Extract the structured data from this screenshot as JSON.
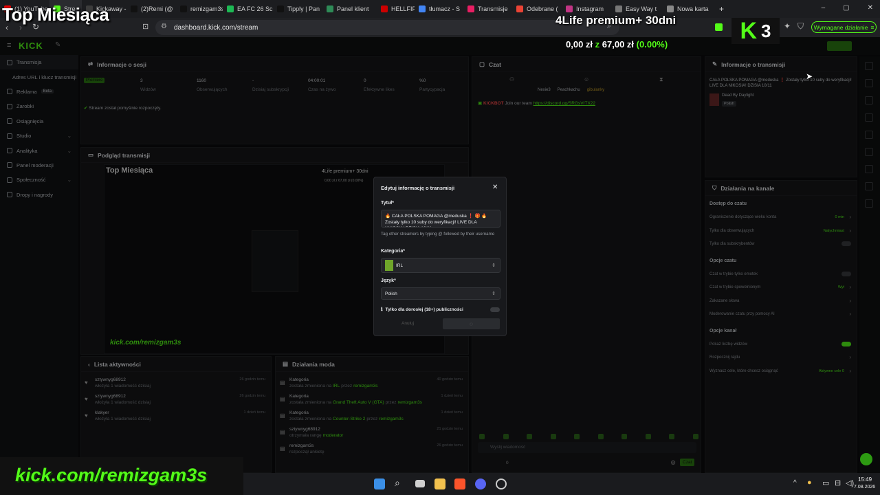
{
  "browser": {
    "tabs": [
      {
        "label": "(1) YouTube",
        "color": "#ff0000"
      },
      {
        "label": "Stre",
        "color": "#53fc18",
        "active": true
      },
      {
        "label": "Kickaway -",
        "color": "#3c3c3c"
      },
      {
        "label": "(2)Remi (@",
        "color": "#111111"
      },
      {
        "label": "remizgam3s",
        "color": "#111111"
      },
      {
        "label": "EA FC 26 Sc",
        "color": "#1db954"
      },
      {
        "label": "Tipply | Pan",
        "color": "#111111"
      },
      {
        "label": "Panel klient",
        "color": "#2e8b57"
      },
      {
        "label": "HELLFIF",
        "color": "#cc0000"
      },
      {
        "label": "tłumacz - S",
        "color": "#4285f4"
      },
      {
        "label": "Transmisje",
        "color": "#e91e63"
      },
      {
        "label": "Odebrane (",
        "color": "#ea4335"
      },
      {
        "label": "Instagram",
        "color": "#c13584"
      },
      {
        "label": "Easy Way t",
        "color": "#777777"
      },
      {
        "label": "Nowa karta",
        "color": "#888888"
      }
    ],
    "new_tab": "+",
    "url": "dashboard.kick.com/stream",
    "required_action": "Wymagane działanie"
  },
  "overlay": {
    "top_title": "Top Miesiąca",
    "premium": "4Life premium+ 30dni",
    "money_left": "0,00 zł",
    "money_z": "z",
    "money_right": "67,00 zł",
    "money_pct": "(0.00%)",
    "kick_badge": "3",
    "banner": "kick.com/remizgam3s"
  },
  "sidebar": {
    "logo": "KICK",
    "items": [
      {
        "label": "Transmisja"
      },
      {
        "label": "Adres URL i klucz transmisji"
      },
      {
        "label": "Reklama",
        "badge": "Beta"
      },
      {
        "label": "Zarobki"
      },
      {
        "label": "Osiągnięcia"
      },
      {
        "label": "Studio"
      },
      {
        "label": "Analityka"
      },
      {
        "label": "Panel moderacji"
      },
      {
        "label": "Społeczność"
      },
      {
        "label": "Dropy i nagrody"
      }
    ]
  },
  "session": {
    "title": "Informacje o sesji",
    "premium_badge": "Premiere",
    "stats": [
      {
        "value": "3",
        "label": "Widzów"
      },
      {
        "value": "1160",
        "label": "Obserwujących"
      },
      {
        "value": "-",
        "label": "Dzisiaj subskrypcji"
      },
      {
        "value": "04:00:01",
        "label": "Czas na żywo"
      },
      {
        "value": "0",
        "label": "Efektywne likes"
      },
      {
        "value": "%0",
        "label": "Partycypacja"
      }
    ],
    "status": "Stream został pomyślnie rozpoczęty."
  },
  "preview": {
    "title": "Podgląd transmisji",
    "inner_title": "Top Miesiąca",
    "inner_premium": "4Life premium+ 30dni",
    "inner_money": "0,00 zł z 67,00 zł (0.00%)",
    "inner_banner": "kick.com/remizgam3s"
  },
  "activity": {
    "title": "Lista aktywności",
    "rows": [
      {
        "name": "sztywnyg68912",
        "sub": "włożyła 1 wiadomość dzisiaj",
        "time": "26 godzin temu"
      },
      {
        "name": "sztywnyg68912",
        "sub": "włożyła 1 wiadomość dzisiaj",
        "time": "26 godzin temu"
      },
      {
        "name": "klakyer",
        "sub": "włożyła 1 wiadomość dzisiaj",
        "time": "1 dzień temu"
      }
    ]
  },
  "mod_actions": {
    "title": "Działania moda",
    "rows": [
      {
        "title": "Kategoria",
        "sub_pre": "została zmieniona na",
        "sub_hl": "IRL",
        "sub_mid": "przez",
        "sub_user": "remizgam3s",
        "time": "40 godzin temu"
      },
      {
        "title": "Kategoria",
        "sub_pre": "została zmieniona na",
        "sub_hl": "Grand Theft Auto V (GTA)",
        "sub_mid": "przez",
        "sub_user": "remizgam3s",
        "time": "1 dzień temu"
      },
      {
        "title": "Kategoria",
        "sub_pre": "została zmieniona na",
        "sub_hl": "Counter-Strike 2",
        "sub_mid": "przez",
        "sub_user": "remizgam3s",
        "time": "1 dzień temu"
      },
      {
        "title": "sztywnyg68912",
        "sub_pre": "otrzymała rangę",
        "sub_hl": "moderator",
        "sub_mid": "",
        "sub_user": "",
        "time": "21 godzin temu"
      },
      {
        "title": "remizgam3s",
        "sub_pre": "rozpoczął ankietę",
        "sub_hl": "",
        "sub_mid": "",
        "sub_user": "",
        "time": "26 godzin temu"
      }
    ]
  },
  "chat": {
    "title": "Czat",
    "users": [
      "Nexie3",
      "Peachkachu",
      "gibulanky"
    ],
    "message_user": "KICKBOT",
    "message_text": "Join our team",
    "message_link": "https://discord.gg/SRGsVrTX22",
    "input_placeholder": "Wyślij wiadomość",
    "counter": "0",
    "send": "Czat"
  },
  "stream_info": {
    "title": "Informacje o transmisji",
    "stream_title": "CAŁA POLSKA POMAGA @meduska ❗ Zostały tylko 10 suby do weryfikacji! LIVE DLA NIKOSIA! DZISIA 10/11",
    "game": "Dead By Daylight",
    "lang": "Polish"
  },
  "channel_actions": {
    "title": "Działania na kanale",
    "sections": [
      {
        "header": "Dostęp do czatu",
        "rows": [
          {
            "label": "Ograniczenie dotyczące wieku konta",
            "value": "0 min"
          },
          {
            "label": "Tylko dla obserwujących",
            "value": "Natychmiast"
          },
          {
            "label": "Tylko dla subskrybentów",
            "value": ""
          }
        ]
      },
      {
        "header": "Opcje czatu",
        "rows": [
          {
            "label": "Czat w trybie tylko emotek",
            "value": ""
          },
          {
            "label": "Czat w trybie spowolnionym",
            "value": "Wył"
          },
          {
            "label": "Zakazane słowa",
            "value": ""
          },
          {
            "label": "Moderowanie czatu przy pomocy AI",
            "value": ""
          }
        ]
      },
      {
        "header": "Opcje kanał",
        "rows": [
          {
            "label": "Pokaż liczbę widzów",
            "value": ""
          },
          {
            "label": "Rozpocznij rajdu",
            "value": ""
          },
          {
            "label": "Wyznacz cele, które chcesz osiągnąć",
            "value": "Aktywne cele 0"
          }
        ]
      }
    ]
  },
  "modal": {
    "title": "Edytuj informację o transmisji",
    "title_label": "Tytuł*",
    "title_value": "🔥 CAŁA POLSKA POMAGA @meduska ❗ 🎁 🔥 Zostały tylko 10 suby do weryfikacji! LIVE DLA NIKOSIA! DZISIA 10/11",
    "tag_hint": "Tag other streamers by typing @ followed by their username",
    "category_label": "Kategoria*",
    "category_value": "IRL",
    "lang_label": "Język*",
    "lang_value": "Polish",
    "adult_label": "Tylko dla dorosłej (18+) publiczności",
    "cancel": "Anuluj"
  },
  "taskbar": {
    "time": "15:49",
    "date": "7.08.2026"
  }
}
